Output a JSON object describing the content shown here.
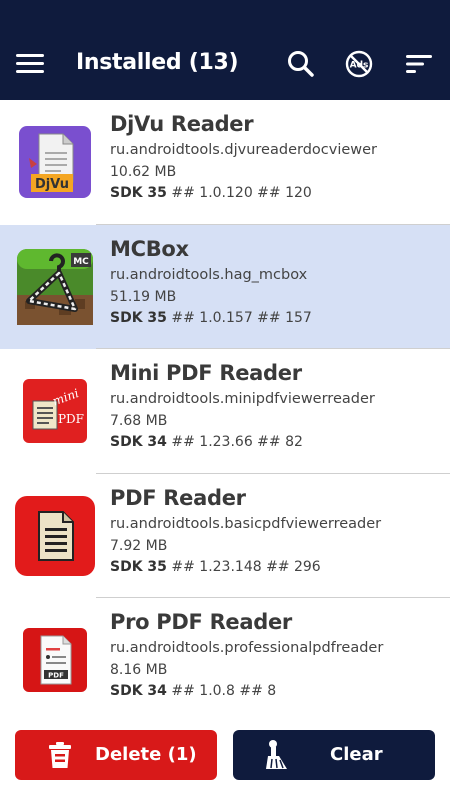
{
  "appbar": {
    "title": "Installed (13)",
    "icons": [
      "menu-icon",
      "search-icon",
      "no-ads-icon",
      "sort-icon"
    ],
    "ads_badge": "Ads"
  },
  "colors": {
    "appbar": "#0f1b3d",
    "selected_row": "#d6e0f5",
    "delete": "#d81919",
    "clear": "#0f1b3d"
  },
  "apps": [
    {
      "name": "DjVu Reader",
      "package": "ru.androidtools.djvureaderdocviewer",
      "size": "10.62 MB",
      "sdk": "SDK 35",
      "version_info": "## 1.0.120 ## 120",
      "icon": "djvu-document-icon",
      "icon_text": "DjVu",
      "selected": false
    },
    {
      "name": "MCBox",
      "package": "ru.androidtools.hag_mcbox",
      "size": "51.19 MB",
      "sdk": "SDK 35",
      "version_info": "## 1.0.157 ## 157",
      "icon": "mcbox-hanger-icon",
      "icon_text": "MC",
      "selected": true
    },
    {
      "name": "Mini PDF Reader",
      "package": "ru.androidtools.minipdfviewerreader",
      "size": "7.68 MB",
      "sdk": "SDK 34",
      "version_info": "## 1.23.66 ## 82",
      "icon": "mini-pdf-icon",
      "icon_text": "mini",
      "icon_text2": "PDF",
      "selected": false
    },
    {
      "name": "PDF Reader",
      "package": "ru.androidtools.basicpdfviewerreader",
      "size": "7.92 MB",
      "sdk": "SDK 35",
      "version_info": "## 1.23.148 ## 296",
      "icon": "pdf-document-icon",
      "selected": false
    },
    {
      "name": "Pro PDF Reader",
      "package": "ru.androidtools.professionalpdfreader",
      "size": "8.16 MB",
      "sdk": "SDK 34",
      "version_info": "## 1.0.8 ## 8",
      "icon": "pro-pdf-icon",
      "icon_text": "PDF",
      "selected": false
    }
  ],
  "actions": {
    "delete_label": "Delete (1)",
    "clear_label": "Clear"
  }
}
